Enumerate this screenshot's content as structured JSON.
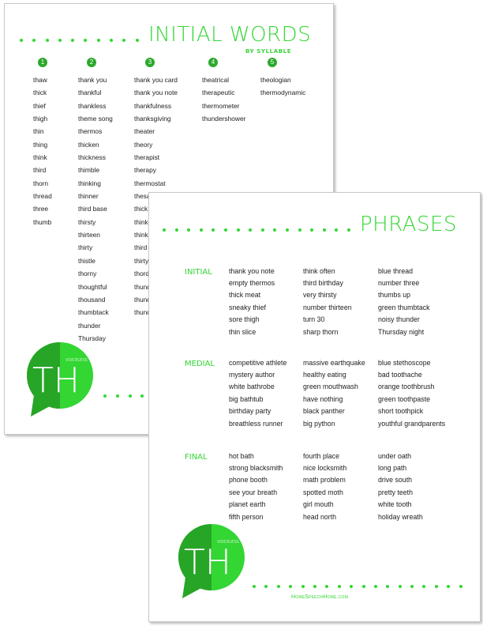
{
  "colors": {
    "accent": "#33d633",
    "logo_dark": "#27a527",
    "logo_light": "#33d633",
    "text": "#222222"
  },
  "back_page": {
    "title": "INITIAL WORDS",
    "subtitle": "BY SYLLABLE",
    "columns": [
      {
        "number": "1",
        "words": [
          "thaw",
          "thick",
          "thief",
          "thigh",
          "thin",
          "thing",
          "think",
          "third",
          "thorn",
          "thread",
          "three",
          "thumb"
        ]
      },
      {
        "number": "2",
        "words": [
          "thank you",
          "thankful",
          "thankless",
          "theme song",
          "thermos",
          "thicken",
          "thickness",
          "thimble",
          "thinking",
          "thinner",
          "third base",
          "thirsty",
          "thirteen",
          "thirty",
          "thistle",
          "thorny",
          "thoughtful",
          "thousand",
          "thumbtack",
          "thunder",
          "Thursday"
        ]
      },
      {
        "number": "3",
        "words": [
          "thank you card",
          "thank you note",
          "thankfulness",
          "thanksgiving",
          "theater",
          "theory",
          "therapist",
          "therapy",
          "thermostat",
          "thesa",
          "thick",
          "think",
          "think",
          "third",
          "thirty",
          "thord",
          "thund",
          "thund",
          "thund"
        ]
      },
      {
        "number": "4",
        "words": [
          "theatrical",
          "therapeutic",
          "thermometer",
          "thundershower"
        ]
      },
      {
        "number": "5",
        "words": [
          "theologian",
          "thermodynamic"
        ]
      }
    ],
    "logo": {
      "letters": "TH",
      "label": "VOICELESS"
    }
  },
  "front_page": {
    "title": "PHRASES",
    "sections": [
      {
        "label": "INITIAL",
        "columns": [
          [
            "thank you note",
            "empty thermos",
            "thick meat",
            "sneaky thief",
            "sore thigh",
            "thin slice"
          ],
          [
            "think often",
            "third birthday",
            "very thirsty",
            "number thirteen",
            "turn 30",
            "sharp thorn"
          ],
          [
            "blue thread",
            "number three",
            "thumbs up",
            "green thumbtack",
            "noisy thunder",
            "Thursday night"
          ]
        ]
      },
      {
        "label": "MEDIAL",
        "columns": [
          [
            "competitive athlete",
            "mystery author",
            "white bathrobe",
            "big bathtub",
            "birthday party",
            "breathless runner"
          ],
          [
            "massive earthquake",
            "healthy eating",
            "green mouthwash",
            "have nothing",
            "black panther",
            "big python"
          ],
          [
            "blue stethoscope",
            "bad toothache",
            "orange toothbrush",
            "green toothpaste",
            "short toothpick",
            "youthful grandparents"
          ]
        ]
      },
      {
        "label": "FINAL",
        "columns": [
          [
            "hot bath",
            "strong blacksmith",
            "phone booth",
            "see your breath",
            "planet earth",
            "fifth person"
          ],
          [
            "fourth place",
            "nice locksmith",
            "math problem",
            "spotted moth",
            "girl mouth",
            "head north"
          ],
          [
            "under oath",
            "long path",
            "drive south",
            "pretty teeth",
            "white tooth",
            "holiday wreath"
          ]
        ]
      }
    ],
    "logo": {
      "letters": "TH",
      "label": "VOICELESS"
    },
    "website": "HomeSpeechHome.com"
  }
}
